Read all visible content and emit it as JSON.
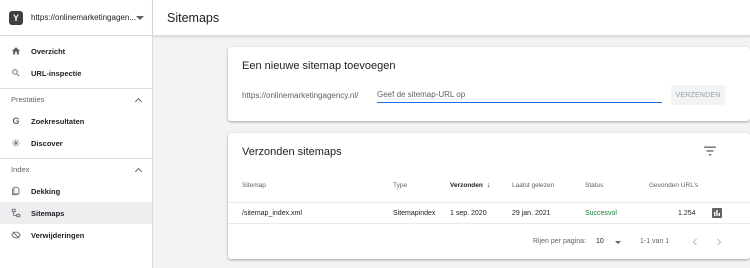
{
  "sidebar": {
    "property": "https://onlinemarketingagen...",
    "items_top": [
      {
        "label": "Overzicht",
        "icon": "home-icon"
      },
      {
        "label": "URL-inspectie",
        "icon": "search-icon"
      }
    ],
    "sections": [
      {
        "title": "Prestaties",
        "items": [
          {
            "label": "Zoekresultaten",
            "icon": "google-icon"
          },
          {
            "label": "Discover",
            "icon": "asterisk-icon"
          }
        ]
      },
      {
        "title": "Index",
        "items": [
          {
            "label": "Dekking",
            "icon": "coverage-icon"
          },
          {
            "label": "Sitemaps",
            "icon": "sitemap-icon",
            "active": true
          },
          {
            "label": "Verwijderingen",
            "icon": "removal-icon"
          }
        ]
      }
    ]
  },
  "header": {
    "title": "Sitemaps"
  },
  "add_card": {
    "title": "Een nieuwe sitemap toevoegen",
    "url_prefix": "https://onlinemarketingagency.nl/",
    "placeholder": "Geef de sitemap-URL op",
    "submit_label": "VERZENDEN"
  },
  "submitted_card": {
    "title": "Verzonden sitemaps",
    "columns": [
      "Sitemap",
      "Type",
      "Verzonden",
      "Laatst gelezen",
      "Status",
      "Gevonden URL's"
    ],
    "rows": [
      {
        "sitemap": "/sitemap_index.xml",
        "type": "Sitemapindex",
        "submitted": "1 sep. 2020",
        "last_read": "29 jan. 2021",
        "status": "Succesvol",
        "urls": "1.254"
      }
    ],
    "pagination": {
      "rows_label": "Rijen per pagina:",
      "rows_value": "10",
      "range": "1-1 van 1"
    }
  },
  "colors": {
    "accent": "#1a73e8",
    "success": "#188038"
  }
}
